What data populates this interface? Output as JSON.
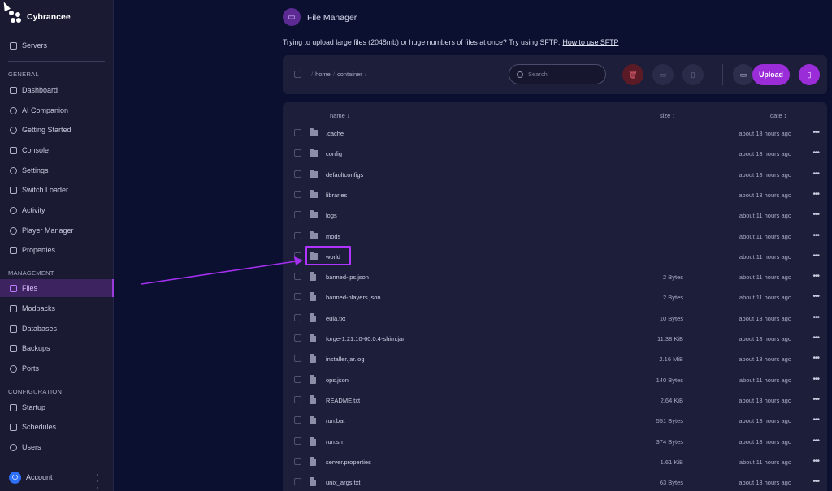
{
  "brand": {
    "name": "Cybrancee"
  },
  "sidebar": {
    "servers_label": "Servers",
    "sections": {
      "general": "GENERAL",
      "management": "MANAGEMENT",
      "configuration": "CONFIGURATION"
    },
    "general_items": [
      "Dashboard",
      "AI Companion",
      "Getting Started",
      "Console",
      "Settings",
      "Switch Loader",
      "Activity",
      "Player Manager",
      "Properties"
    ],
    "management_items": [
      "Files",
      "Modpacks",
      "Databases",
      "Backups",
      "Ports"
    ],
    "configuration_items": [
      "Startup",
      "Schedules",
      "Users"
    ],
    "active_item": "Files",
    "account_label": "Account"
  },
  "header": {
    "title": "File Manager",
    "notice": "Trying to upload large files (2048mb) or huge numbers of files at once? Try using SFTP:",
    "notice_link": "How to use SFTP"
  },
  "toolbar": {
    "breadcrumb": [
      "home",
      "container"
    ],
    "search_placeholder": "Search",
    "upload_label": "Upload"
  },
  "table": {
    "headers": {
      "name": "name ↓",
      "size": "size ↕",
      "date": "date ↕"
    },
    "rows": [
      {
        "type": "folder",
        "name": ".cache",
        "size": "",
        "date": "about 13 hours ago"
      },
      {
        "type": "folder",
        "name": "config",
        "size": "",
        "date": "about 13 hours ago"
      },
      {
        "type": "folder",
        "name": "defaultconfigs",
        "size": "",
        "date": "about 13 hours ago"
      },
      {
        "type": "folder",
        "name": "libraries",
        "size": "",
        "date": "about 13 hours ago"
      },
      {
        "type": "folder",
        "name": "logs",
        "size": "",
        "date": "about 11 hours ago"
      },
      {
        "type": "folder",
        "name": "mods",
        "size": "",
        "date": "about 11 hours ago"
      },
      {
        "type": "folder",
        "name": "world",
        "size": "",
        "date": "about 11 hours ago"
      },
      {
        "type": "file",
        "name": "banned-ips.json",
        "size": "2 Bytes",
        "date": "about 11 hours ago"
      },
      {
        "type": "file",
        "name": "banned-players.json",
        "size": "2 Bytes",
        "date": "about 11 hours ago"
      },
      {
        "type": "file",
        "name": "eula.txt",
        "size": "10 Bytes",
        "date": "about 13 hours ago"
      },
      {
        "type": "file",
        "name": "forge-1.21.10-60.0.4-shim.jar",
        "size": "11.38 KiB",
        "date": "about 13 hours ago"
      },
      {
        "type": "file",
        "name": "installer.jar.log",
        "size": "2.16 MiB",
        "date": "about 13 hours ago"
      },
      {
        "type": "file",
        "name": "ops.json",
        "size": "140 Bytes",
        "date": "about 11 hours ago"
      },
      {
        "type": "file",
        "name": "README.txt",
        "size": "2.64 KiB",
        "date": "about 13 hours ago"
      },
      {
        "type": "file",
        "name": "run.bat",
        "size": "551 Bytes",
        "date": "about 13 hours ago"
      },
      {
        "type": "file",
        "name": "run.sh",
        "size": "374 Bytes",
        "date": "about 13 hours ago"
      },
      {
        "type": "file",
        "name": "server.properties",
        "size": "1.61 KiB",
        "date": "about 11 hours ago"
      },
      {
        "type": "file",
        "name": "unix_args.txt",
        "size": "63 Bytes",
        "date": "about 13 hours ago"
      }
    ]
  },
  "colors": {
    "accent": "#9a2dd8",
    "highlight": "#b033ff",
    "background": "#0b1030",
    "panel": "#1d1e3a"
  }
}
